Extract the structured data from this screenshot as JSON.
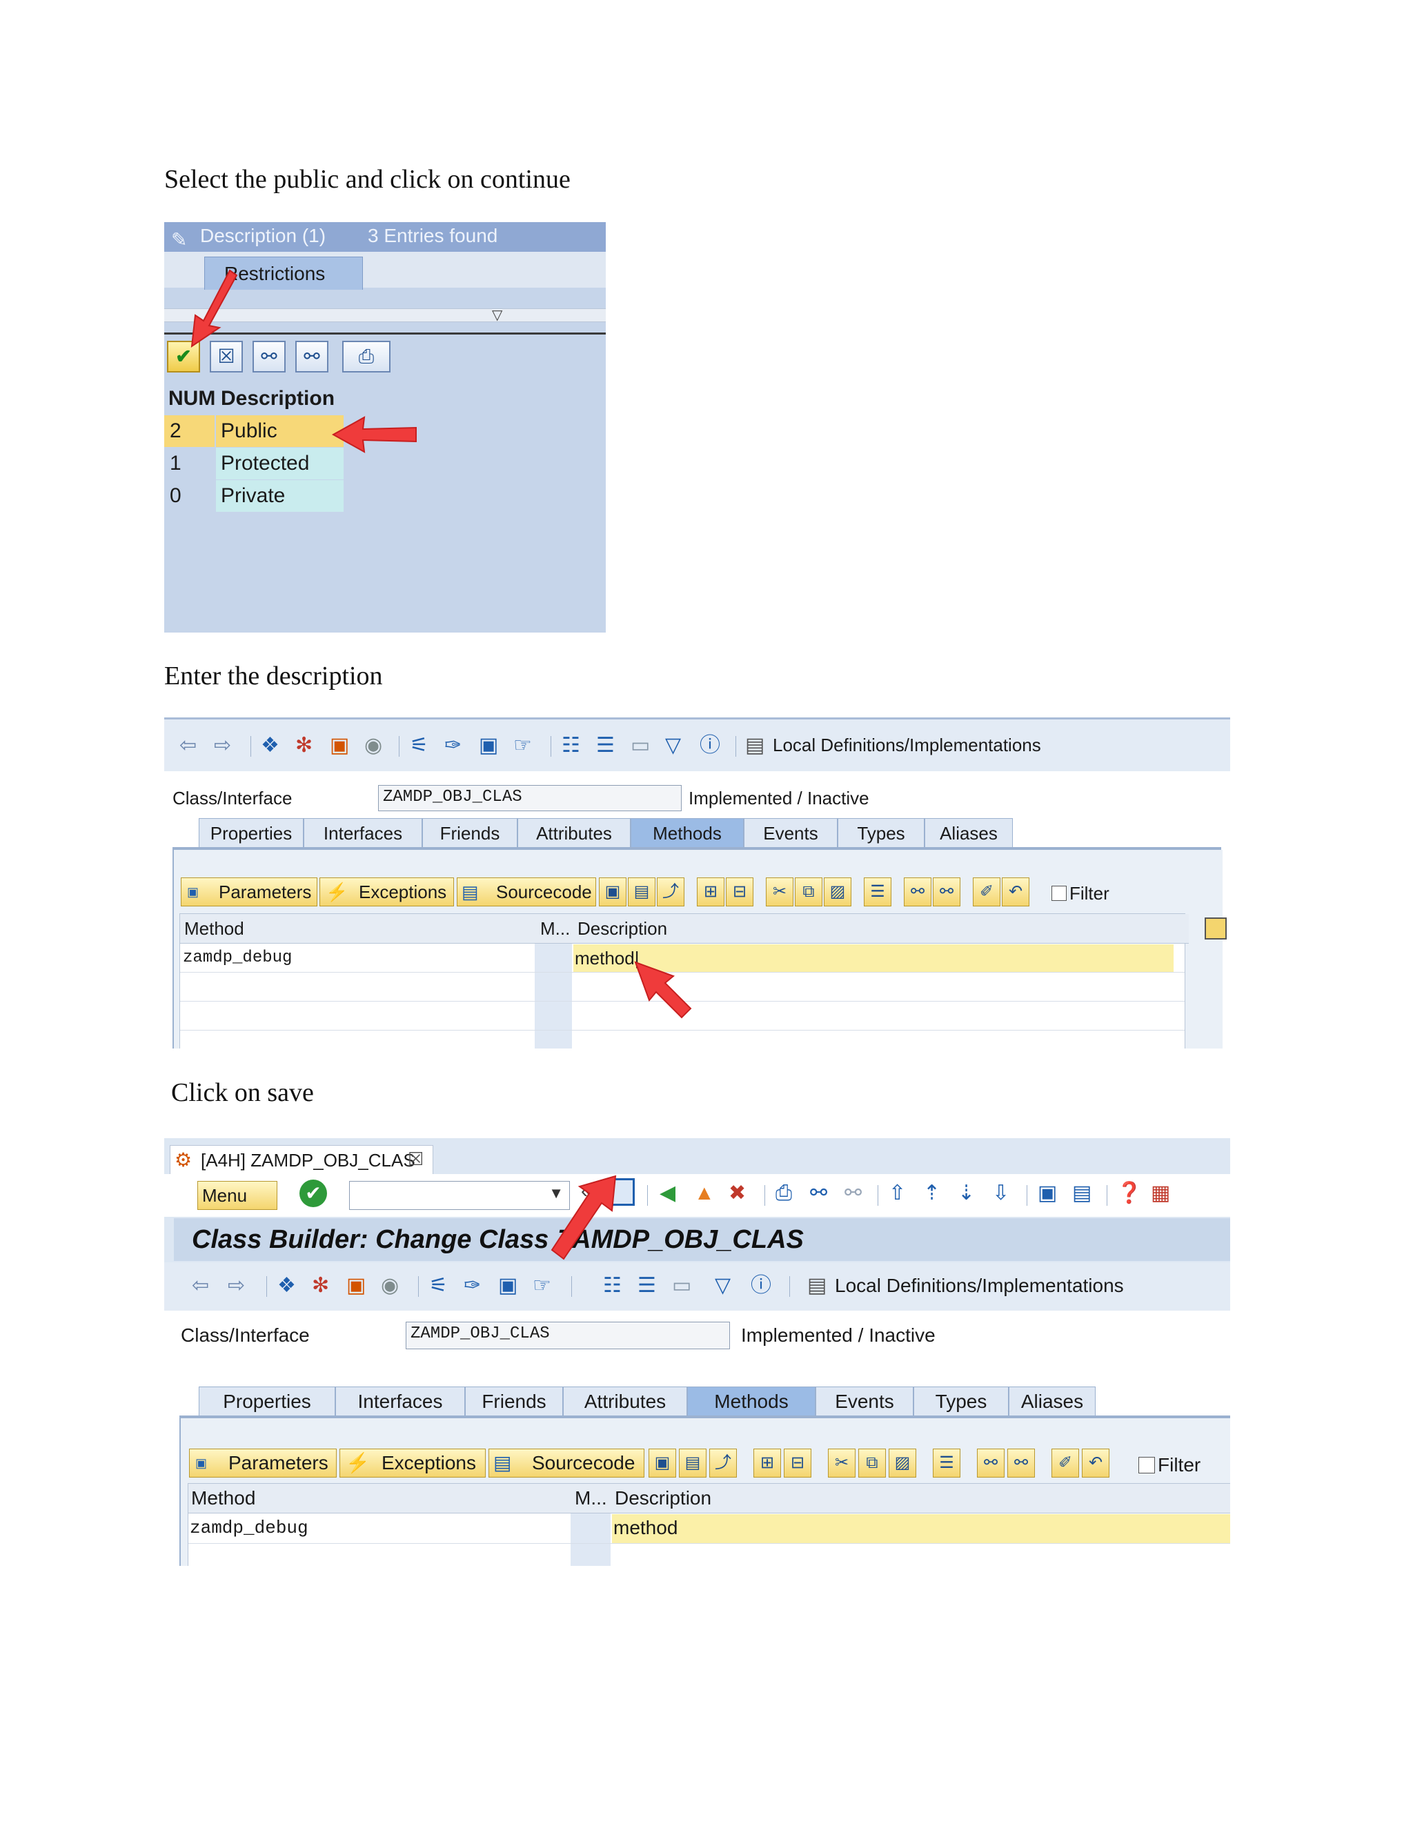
{
  "step1": {
    "caption": "Select the public and click on continue",
    "window_title": "Description (1)",
    "entries_found": "3 Entries found",
    "tab_label": "Restrictions",
    "columns": [
      "NUM",
      "Description"
    ],
    "rows": [
      {
        "num": "2",
        "desc": "Public"
      },
      {
        "num": "1",
        "desc": "Protected"
      },
      {
        "num": "0",
        "desc": "Private"
      }
    ]
  },
  "step2": {
    "caption": "Enter the description",
    "local_defs": "Local Definitions/Implementations",
    "class_label": "Class/Interface",
    "class_value": "ZAMDP_OBJ_CLAS",
    "status": "Implemented / Inactive",
    "tabs": [
      "Properties",
      "Interfaces",
      "Friends",
      "Attributes",
      "Methods",
      "Events",
      "Types",
      "Aliases"
    ],
    "buttons": {
      "parameters": "Parameters",
      "exceptions": "Exceptions",
      "sourcecode": "Sourcecode",
      "filter": "Filter"
    },
    "grid": {
      "col_method": "Method",
      "col_m": "M...",
      "col_desc": "Description",
      "method": "zamdp_debug",
      "desc": "method"
    }
  },
  "step3": {
    "caption": "Click on save",
    "tab_title": "[A4H] ZAMDP_OBJ_CLAS",
    "menu_label": "Menu",
    "header_title": "Class Builder: Change Class ZAMDP_OBJ_CLAS",
    "local_defs": "Local Definitions/Implementations",
    "class_label": "Class/Interface",
    "class_value": "ZAMDP_OBJ_CLAS",
    "status": "Implemented / Inactive",
    "tabs": [
      "Properties",
      "Interfaces",
      "Friends",
      "Attributes",
      "Methods",
      "Events",
      "Types",
      "Aliases"
    ],
    "buttons": {
      "parameters": "Parameters",
      "exceptions": "Exceptions",
      "sourcecode": "Sourcecode",
      "filter": "Filter"
    },
    "grid": {
      "col_method": "Method",
      "col_m": "M...",
      "col_desc": "Description",
      "method": "zamdp_debug",
      "desc": "method"
    }
  },
  "colors": {
    "sap_blue": "#c6d5ea",
    "highlight": "#fbf0a8",
    "selection": "#f7d878",
    "cyan_cell": "#c9ecee",
    "arrow": "#ef3b3b"
  }
}
